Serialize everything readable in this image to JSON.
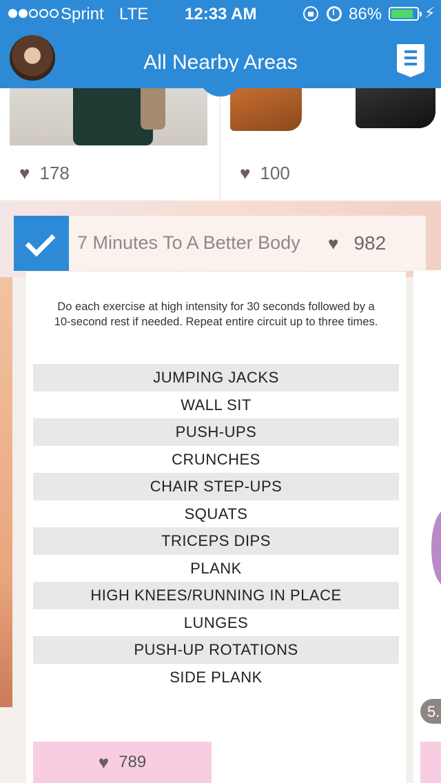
{
  "status_bar": {
    "carrier": "Sprint",
    "network": "LTE",
    "time": "12:33 AM",
    "battery_percent": "86%",
    "battery_level": 0.86,
    "icons": [
      "signal-dots",
      "rotation-lock-icon",
      "alarm-icon",
      "battery-icon",
      "charging-bolt-icon"
    ]
  },
  "header": {
    "title": "All Nearby Areas",
    "accent_color": "#2d8ad6"
  },
  "cards_top": [
    {
      "image": "dress-photo",
      "likes": "178"
    },
    {
      "image": "boots-photo",
      "likes": "100"
    }
  ],
  "feature": {
    "title": "7 Minutes To A Better Body",
    "likes": "982",
    "instructions": "Do each exercise at high intensity for 30 seconds followed by a 10-second rest if needed. Repeat entire circuit up to three times.",
    "exercises": [
      "JUMPING JACKS",
      "WALL SIT",
      "PUSH-UPS",
      "CRUNCHES",
      "CHAIR STEP-UPS",
      "SQUATS",
      "TRICEPS DIPS",
      "PLANK",
      "HIGH KNEES/RUNNING IN PLACE",
      "LUNGES",
      "PUSH-UP ROTATIONS",
      "SIDE PLANK"
    ],
    "bottom_likes": "789"
  },
  "side_card": {
    "count_partial": "5."
  }
}
